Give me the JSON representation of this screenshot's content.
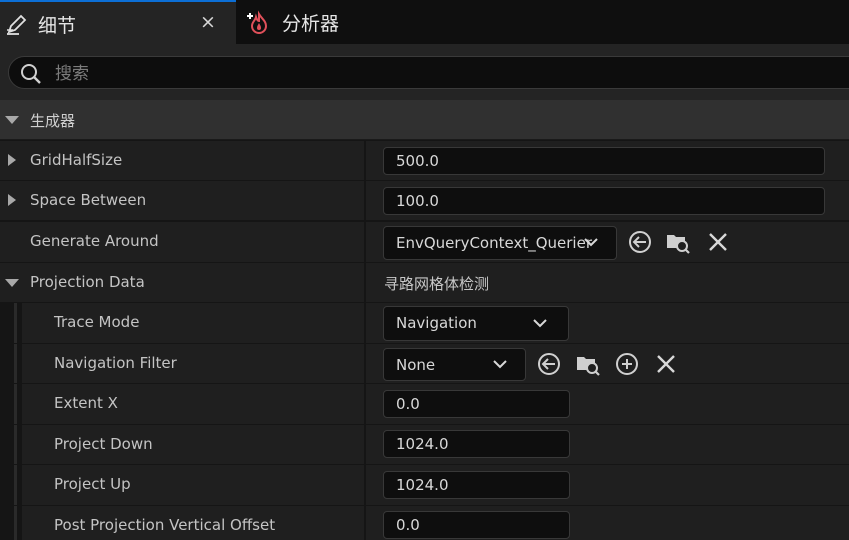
{
  "tabs": [
    {
      "label": "细节",
      "icon": "pencil-icon",
      "active": true
    },
    {
      "label": "分析器",
      "icon": "profiler-icon",
      "active": false
    }
  ],
  "tab_close": "×",
  "search": {
    "placeholder": "搜索",
    "value": ""
  },
  "category": {
    "label": "生成器"
  },
  "rows": {
    "grid_half_size": {
      "label": "GridHalfSize",
      "value": "500.0"
    },
    "space_between": {
      "label": "Space Between",
      "value": "100.0"
    },
    "generate_around": {
      "label": "Generate Around",
      "value": "EnvQueryContext_Querier"
    },
    "projection_data": {
      "label": "Projection Data",
      "value": "寻路网格体检测"
    },
    "trace_mode": {
      "label": "Trace Mode",
      "value": "Navigation"
    },
    "navigation_filter": {
      "label": "Navigation Filter",
      "value": "None"
    },
    "extent_x": {
      "label": "Extent X",
      "value": "0.0"
    },
    "project_down": {
      "label": "Project Down",
      "value": "1024.0"
    },
    "project_up": {
      "label": "Project Up",
      "value": "1024.0"
    },
    "post_projection_vertical_offset": {
      "label": "Post Projection Vertical Offset",
      "value": "0.0"
    }
  },
  "colors": {
    "accent": "#0c6fd6",
    "panel": "#1f1f1f",
    "header": "#303030",
    "field": "#0e0e0e"
  }
}
